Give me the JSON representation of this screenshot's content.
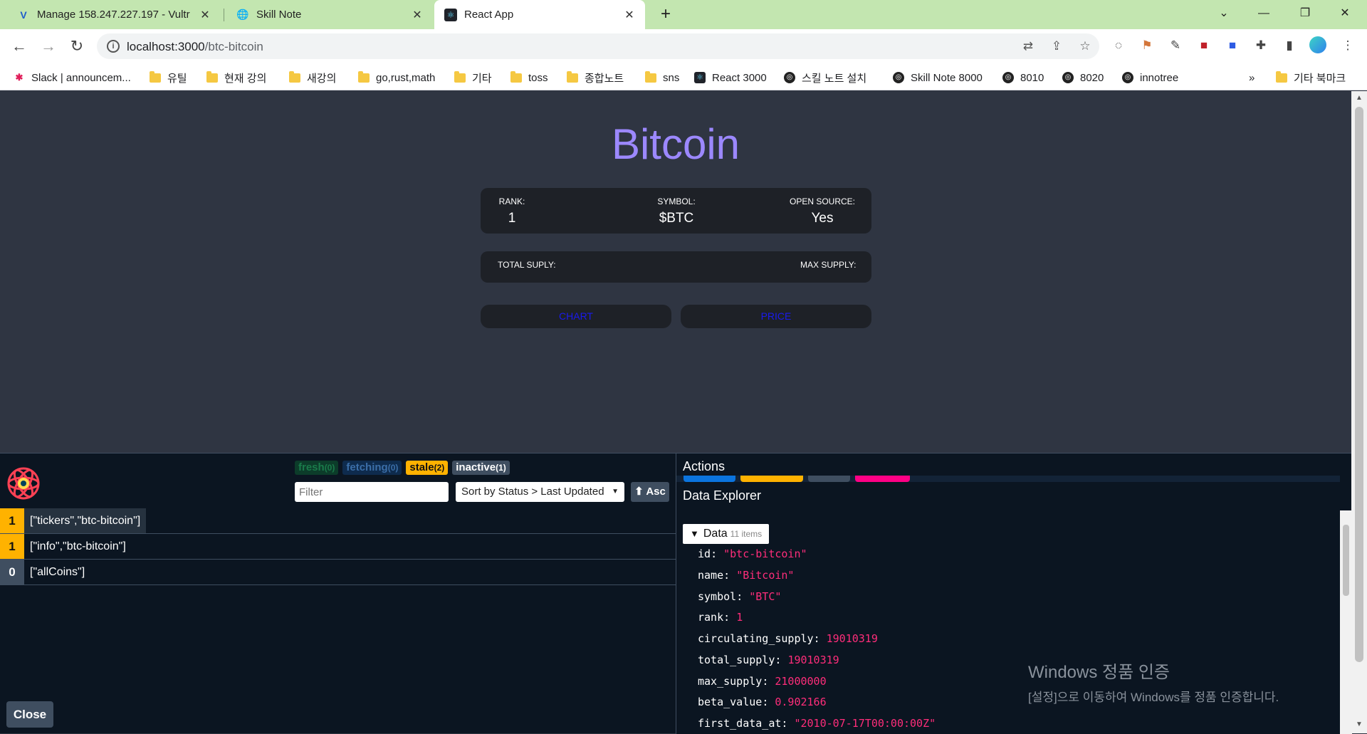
{
  "browser": {
    "tabs": [
      {
        "title": "Manage 158.247.227.197 - Vultr",
        "favicon": "vultr-icon"
      },
      {
        "title": "Skill Note",
        "favicon": "globe-icon"
      },
      {
        "title": "React App",
        "favicon": "react-icon"
      }
    ],
    "url_host": "localhost:3000",
    "url_path": "/btc-bitcoin",
    "bookmarks": [
      {
        "label": "Slack | announcem...",
        "icon": "slack-icon"
      },
      {
        "label": "유틸",
        "icon": "folder-icon"
      },
      {
        "label": "현재 강의",
        "icon": "folder-icon"
      },
      {
        "label": "새강의",
        "icon": "folder-icon"
      },
      {
        "label": "go,rust,math",
        "icon": "folder-icon"
      },
      {
        "label": "기타",
        "icon": "folder-icon"
      },
      {
        "label": "toss",
        "icon": "folder-icon"
      },
      {
        "label": "종합노트",
        "icon": "folder-icon"
      },
      {
        "label": "sns",
        "icon": "folder-icon"
      },
      {
        "label": "React 3000",
        "icon": "react-icon"
      },
      {
        "label": "스킬 노트 설치",
        "icon": "globe-icon"
      },
      {
        "label": "Skill Note 8000",
        "icon": "globe-icon"
      },
      {
        "label": "8010",
        "icon": "globe-icon"
      },
      {
        "label": "8020",
        "icon": "globe-icon"
      },
      {
        "label": "innotree",
        "icon": "globe-icon"
      }
    ],
    "bookmarks_more": "»",
    "other_bookmarks": "기타 북마크"
  },
  "coin": {
    "title": "Bitcoin",
    "rank_label": "RANK:",
    "rank": "1",
    "symbol_label": "SYMBOL:",
    "symbol": "$BTC",
    "open_source_label": "OPEN SOURCE:",
    "open_source": "Yes",
    "total_supply_label": "TOTAL SUPLY:",
    "max_supply_label": "MAX SUPPLY:",
    "chart_tab": "CHART",
    "price_tab": "PRICE"
  },
  "devtools": {
    "badges": {
      "fresh": "fresh",
      "fresh_count": "(0)",
      "fetching": "fetching",
      "fetching_count": "(0)",
      "stale": "stale",
      "stale_count": "(2)",
      "inactive": "inactive",
      "inactive_count": "(1)"
    },
    "filter_placeholder": "Filter",
    "sort_label": "Sort by Status > Last Updated",
    "asc_label": "⬆ Asc",
    "queries": [
      {
        "count": "1",
        "key": "[\"tickers\",\"btc-bitcoin\"]",
        "status_color": "#ffb200"
      },
      {
        "count": "1",
        "key": "[\"info\",\"btc-bitcoin\"]",
        "status_color": "#ffb200"
      },
      {
        "count": "0",
        "key": "[\"allCoins\"]",
        "status_color": "#3f4e60"
      }
    ],
    "close_label": "Close",
    "actions_title": "Actions",
    "action_colors": [
      "#0b74de",
      "#ffb200",
      "#3f4e60",
      "#ff0085"
    ],
    "explorer_title": "Data Explorer",
    "data_label": "Data",
    "data_count": "11 items",
    "fields": [
      {
        "key": "id",
        "value": "\"btc-bitcoin\""
      },
      {
        "key": "name",
        "value": "\"Bitcoin\""
      },
      {
        "key": "symbol",
        "value": "\"BTC\""
      },
      {
        "key": "rank",
        "value": "1"
      },
      {
        "key": "circulating_supply",
        "value": "19010319"
      },
      {
        "key": "total_supply",
        "value": "19010319"
      },
      {
        "key": "max_supply",
        "value": "21000000"
      },
      {
        "key": "beta_value",
        "value": "0.902166"
      },
      {
        "key": "first_data_at",
        "value": "\"2010-07-17T00:00:00Z\""
      }
    ]
  },
  "watermark": {
    "line1": "Windows 정품 인증",
    "line2": "[설정]으로 이동하여 Windows를 정품 인증합니다."
  }
}
